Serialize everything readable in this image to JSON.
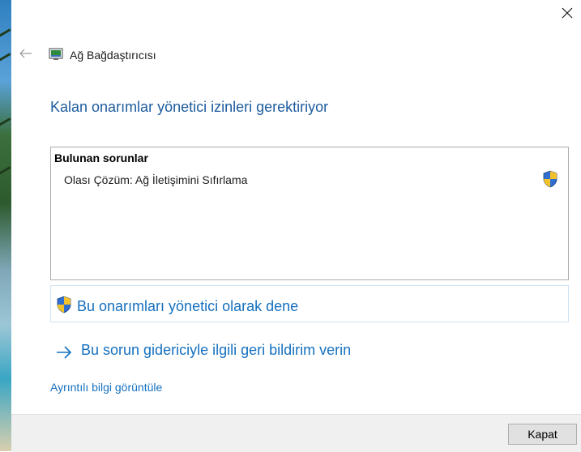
{
  "app": {
    "title": "Ağ Bağdaştırıcısı",
    "icon": "network-adapter-icon"
  },
  "main": {
    "heading": "Kalan onarımlar yönetici izinleri gerektiriyor",
    "issues_box": {
      "heading": "Bulunan sorunlar",
      "items": [
        {
          "label": "Olası Çözüm: Ağ İletişimini Sıfırlama",
          "icon": "uac-shield-icon"
        }
      ]
    },
    "admin_link": {
      "label": "Bu onarımları yönetici olarak dene",
      "icon": "uac-shield-icon"
    },
    "feedback_link": {
      "label": "Bu sorun gidericiyle ilgili geri bildirim verin",
      "icon": "arrow-right-icon"
    },
    "details_link": {
      "label": "Ayrıntılı bilgi görüntüle"
    }
  },
  "footer": {
    "close_label": "Kapat"
  },
  "colors": {
    "heading": "#1d5c9e",
    "link": "#1570c0",
    "footer_bg": "#f0f0f0",
    "button_bg": "#e1e1e1"
  }
}
